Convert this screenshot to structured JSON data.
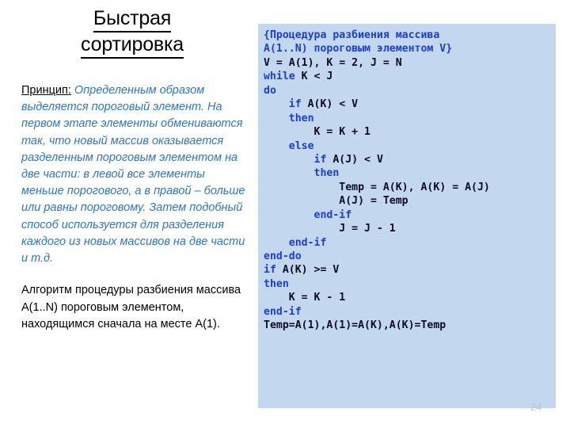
{
  "slide": {
    "title_line1": "Быстрая",
    "title_line2": "сортировка",
    "page_number": "24",
    "colors": {
      "code_panel_bg": "#C3D7EF",
      "keyword_blue": "#1B3FD2",
      "identifier_navy": "#0B0B26",
      "body_blue": "#2E74C8",
      "text_black": "#000000",
      "page_number_gray": "#B9C0CE"
    }
  },
  "principle": {
    "label": "Принцип:",
    "text": " Определенным образом выделяется пороговый элемент. На первом этапе элементы обмениваются так, что новый массив оказывается разделенным пороговым элементом на две части: в левой все элементы меньше порогового, а в правой – больше или равны пороговому. Затем подобный способ используется для разделения каждого из новых массивов на две части и т.д."
  },
  "algorithm": {
    "text": "Алгоритм процедуры разбиения массива A(1..N) пороговым элементом, находящимся сначала на месте A(1)."
  },
  "code": {
    "language": "pseudocode",
    "lines": [
      {
        "indent": 0,
        "tokens": [
          {
            "t": "{Процедура разбиения массива",
            "c": "cmt"
          }
        ]
      },
      {
        "indent": 0,
        "tokens": [
          {
            "t": "A(1..N) пороговым элементом V}",
            "c": "cmt"
          }
        ]
      },
      {
        "indent": 0,
        "tokens": [
          {
            "t": "V = A(1), K = 2, J = N",
            "c": "id"
          }
        ]
      },
      {
        "indent": 0,
        "tokens": [
          {
            "t": "while",
            "c": "kw"
          },
          {
            "t": " K < J",
            "c": "id"
          }
        ]
      },
      {
        "indent": 0,
        "tokens": [
          {
            "t": "do",
            "c": "kw"
          }
        ]
      },
      {
        "indent": 1,
        "tokens": [
          {
            "t": "if",
            "c": "kw"
          },
          {
            "t": " A(K) < V",
            "c": "id"
          }
        ]
      },
      {
        "indent": 1,
        "tokens": [
          {
            "t": "then",
            "c": "kw"
          }
        ]
      },
      {
        "indent": 2,
        "tokens": [
          {
            "t": "K = K + 1",
            "c": "id"
          }
        ]
      },
      {
        "indent": 1,
        "tokens": [
          {
            "t": "else",
            "c": "kw"
          }
        ]
      },
      {
        "indent": 2,
        "tokens": [
          {
            "t": "if",
            "c": "kw"
          },
          {
            "t": " A(J) < V",
            "c": "id"
          }
        ]
      },
      {
        "indent": 2,
        "tokens": [
          {
            "t": "then",
            "c": "kw"
          }
        ]
      },
      {
        "indent": 3,
        "tokens": [
          {
            "t": "Temp = A(K), A(K) = A(J)",
            "c": "id"
          }
        ]
      },
      {
        "indent": 3,
        "tokens": [
          {
            "t": "A(J) = Temp",
            "c": "id"
          }
        ]
      },
      {
        "indent": 2,
        "tokens": [
          {
            "t": "end-if",
            "c": "kw"
          }
        ]
      },
      {
        "indent": 3,
        "tokens": [
          {
            "t": "J = J - 1",
            "c": "id"
          }
        ]
      },
      {
        "indent": 1,
        "tokens": [
          {
            "t": "end-if",
            "c": "kw"
          }
        ]
      },
      {
        "indent": 0,
        "tokens": [
          {
            "t": "end-do",
            "c": "kw"
          }
        ]
      },
      {
        "indent": 0,
        "tokens": [
          {
            "t": "if",
            "c": "kw"
          },
          {
            "t": " A(K) >= V",
            "c": "id"
          }
        ]
      },
      {
        "indent": 0,
        "tokens": [
          {
            "t": "then",
            "c": "kw"
          }
        ]
      },
      {
        "indent": 1,
        "tokens": [
          {
            "t": "K = K - 1",
            "c": "id"
          }
        ]
      },
      {
        "indent": 0,
        "tokens": [
          {
            "t": "end-if",
            "c": "kw"
          }
        ]
      },
      {
        "indent": 0,
        "tokens": [
          {
            "t": "Temp=A(1),A(1)=A(K),A(K)=Temp",
            "c": "id"
          }
        ]
      }
    ]
  }
}
